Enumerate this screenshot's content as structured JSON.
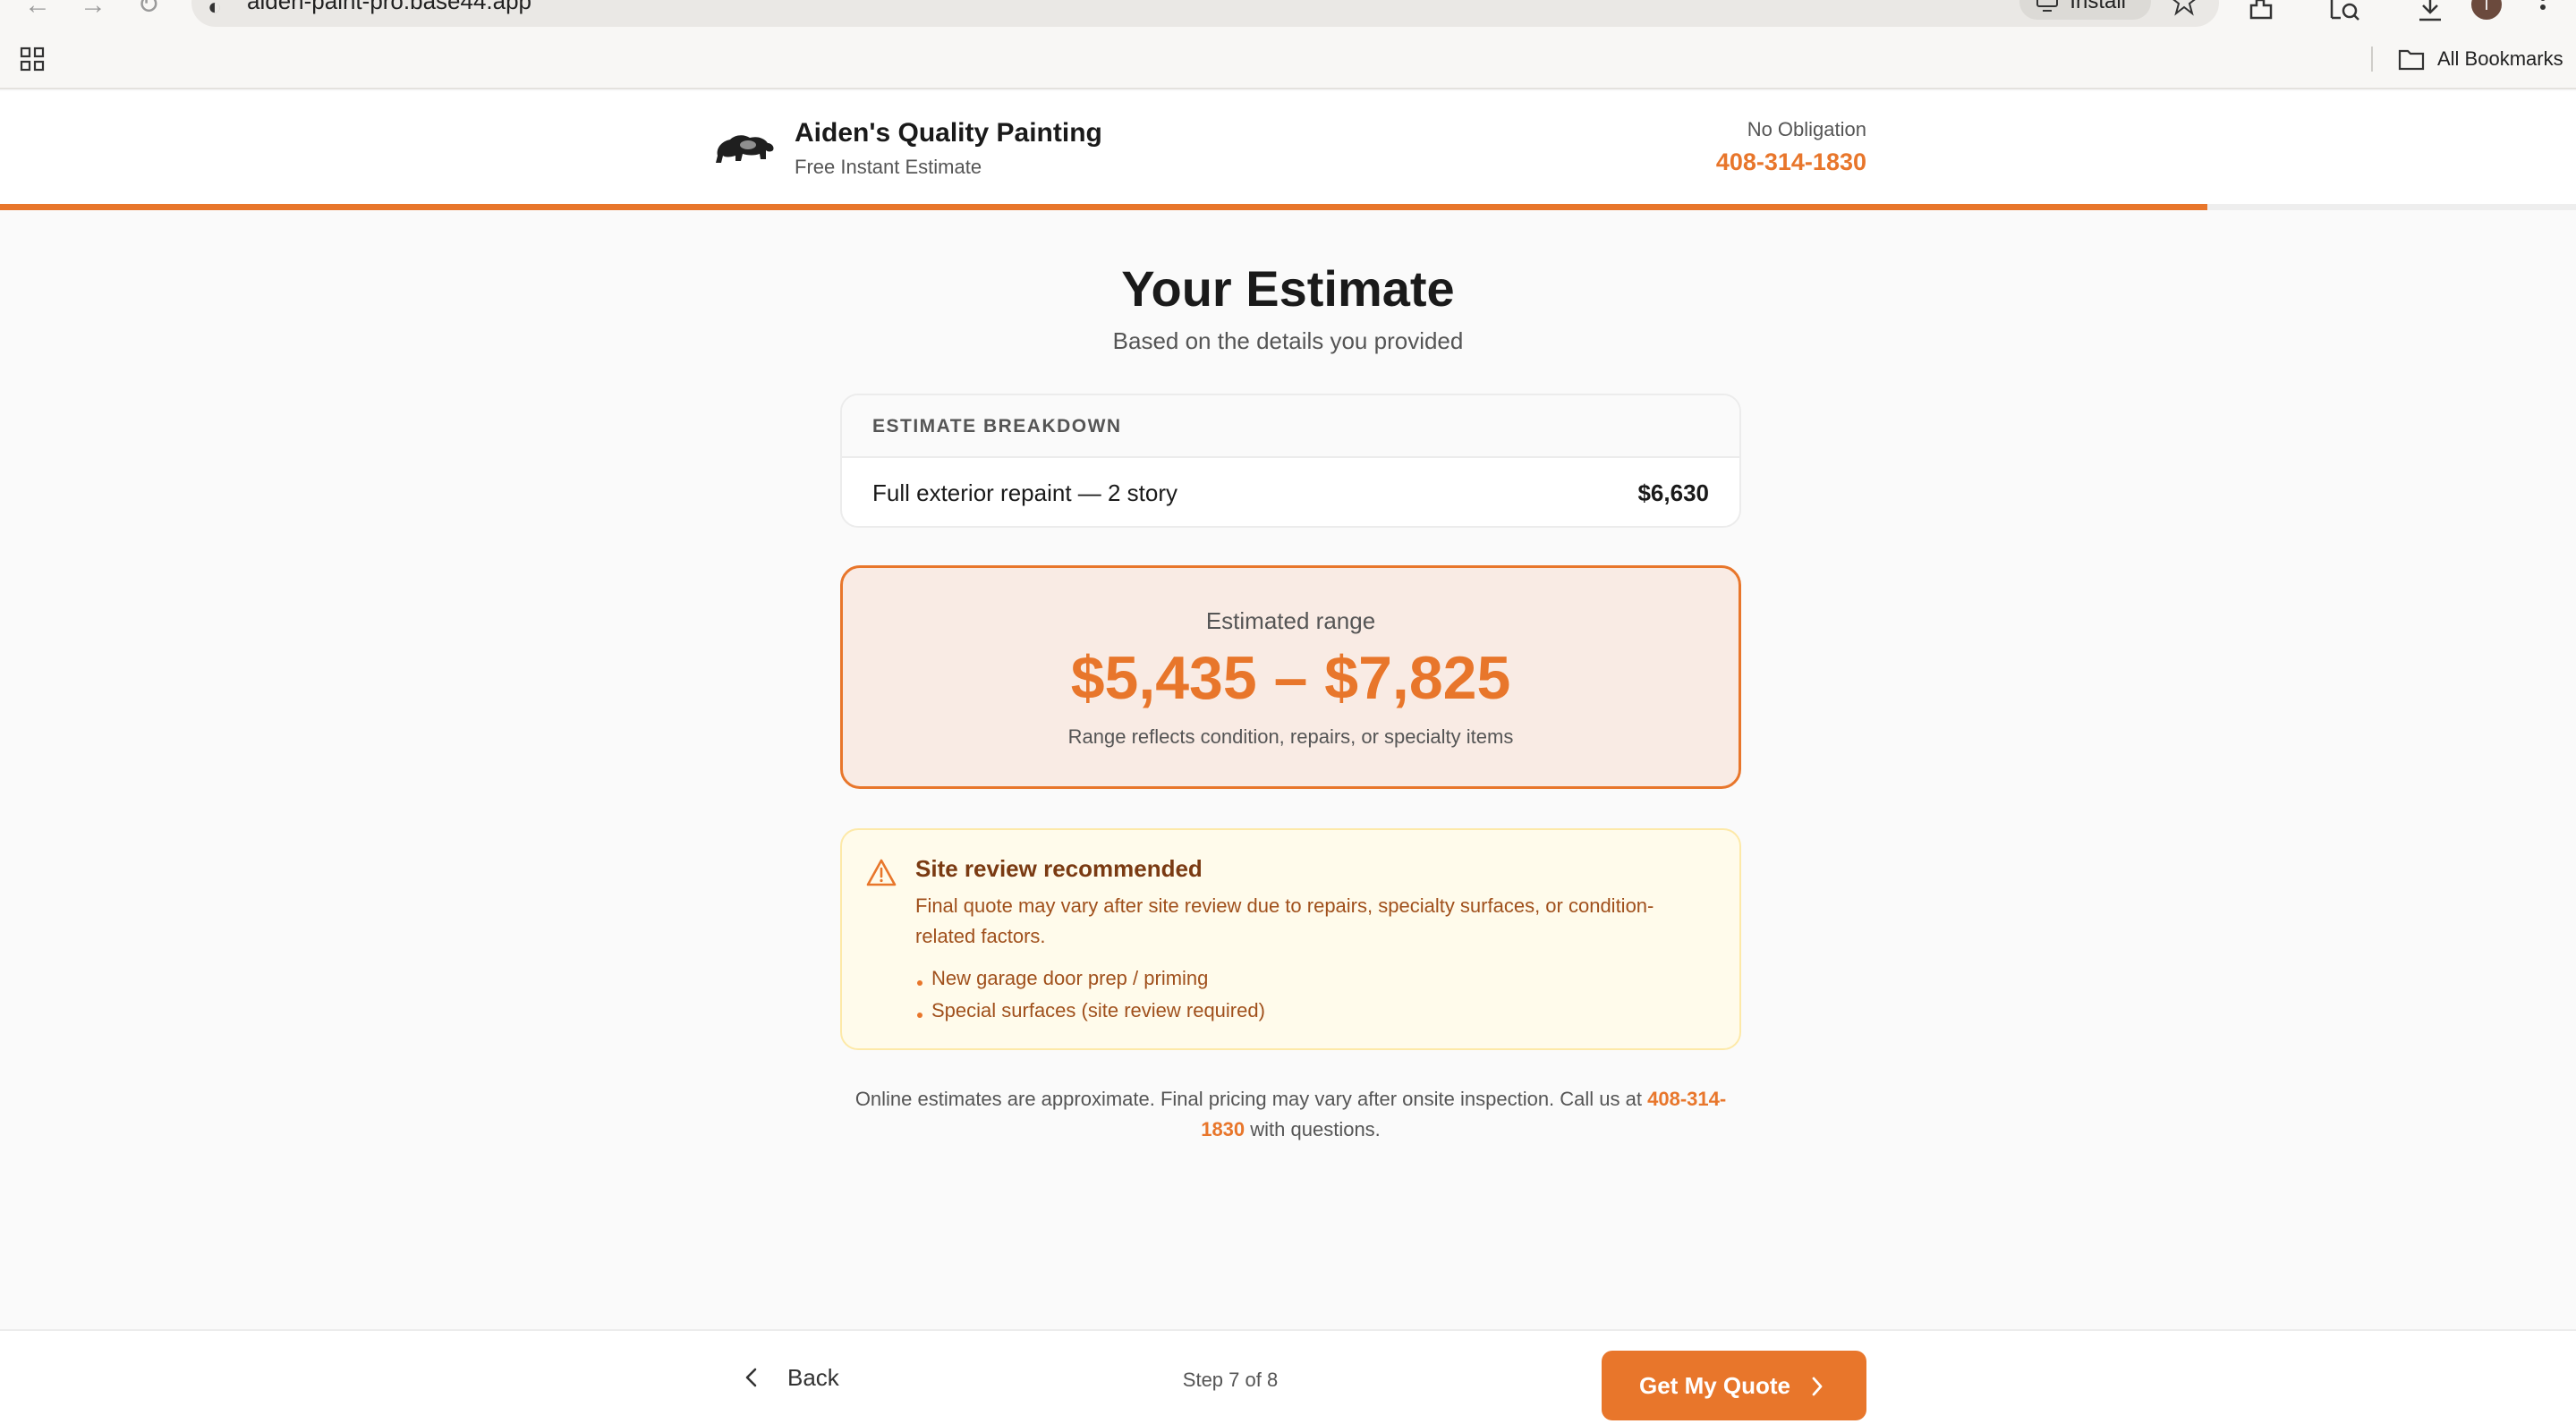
{
  "browser": {
    "url": "aiden-paint-pro.base44.app",
    "install_label": "Install",
    "avatar_initial": "T",
    "bookmarks_label": "All Bookmarks"
  },
  "header": {
    "brand_name": "Aiden's Quality Painting",
    "brand_tagline": "Free Instant Estimate",
    "no_obligation": "No Obligation",
    "phone": "408-314-1830",
    "progress_fraction": 0.857
  },
  "main": {
    "title": "Your Estimate",
    "subtitle": "Based on the details you provided",
    "breakdown": {
      "heading": "ESTIMATE BREAKDOWN",
      "items": [
        {
          "label": "Full exterior repaint — 2 story",
          "amount": "$6,630"
        }
      ]
    },
    "range": {
      "label": "Estimated range",
      "value": "$5,435 – $7,825",
      "note": "Range reflects condition, repairs, or specialty items"
    },
    "review": {
      "title": "Site review recommended",
      "body": "Final quote may vary after site review due to repairs, specialty surfaces, or condition-related factors.",
      "items": [
        "New garage door prep / priming",
        "Special surfaces (site review required)"
      ]
    },
    "disclaimer": {
      "text_before": "Online estimates are approximate. Final pricing may vary after onsite inspection. Call us at ",
      "phone": "408-314-1830",
      "text_after": " with questions."
    }
  },
  "footer": {
    "back_label": "Back",
    "step_text": "Step 7 of 8",
    "cta_label": "Get My Quote"
  },
  "colors": {
    "accent": "#e8762b",
    "range_bg": "#f9ebe4",
    "warning_bg": "#fffbeb",
    "warning_border": "#fde9a8",
    "warning_text": "#a0501c"
  },
  "icons": {
    "logo": "bear-logo-icon",
    "warning": "warning-triangle-icon",
    "back": "chevron-left-icon",
    "cta": "chevron-right-icon"
  }
}
